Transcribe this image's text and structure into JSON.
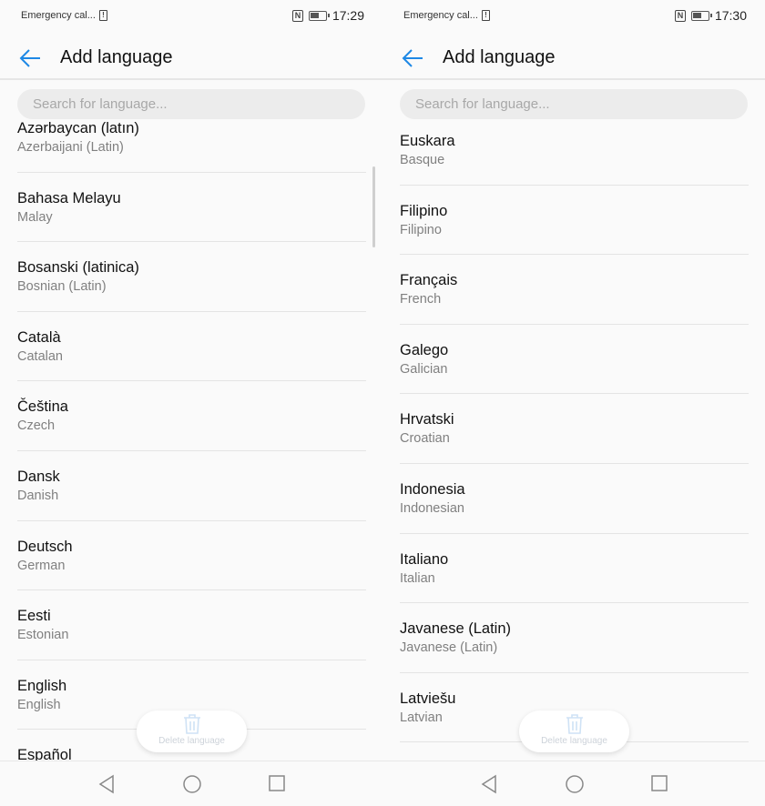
{
  "panels": [
    {
      "status": {
        "carrier": "Emergency cal...",
        "time": "17:29"
      },
      "header": {
        "title": "Add language"
      },
      "search": {
        "placeholder": "Search for language..."
      },
      "languages": [
        {
          "name": "Azərbaycan (latın)",
          "sub": "Azerbaijani (Latin)"
        },
        {
          "name": "Bahasa Melayu",
          "sub": "Malay"
        },
        {
          "name": "Bosanski (latinica)",
          "sub": "Bosnian (Latin)"
        },
        {
          "name": "Català",
          "sub": "Catalan"
        },
        {
          "name": "Čeština",
          "sub": "Czech"
        },
        {
          "name": "Dansk",
          "sub": "Danish"
        },
        {
          "name": "Deutsch",
          "sub": "German"
        },
        {
          "name": "Eesti",
          "sub": "Estonian"
        },
        {
          "name": "English",
          "sub": "English"
        },
        {
          "name": "Español",
          "sub": ""
        }
      ],
      "delete_label": "Delete language"
    },
    {
      "status": {
        "carrier": "Emergency cal...",
        "time": "17:30"
      },
      "header": {
        "title": "Add language"
      },
      "search": {
        "placeholder": "Search for language..."
      },
      "languages": [
        {
          "name": "Euskara",
          "sub": "Basque"
        },
        {
          "name": "Filipino",
          "sub": "Filipino"
        },
        {
          "name": "Français",
          "sub": "French"
        },
        {
          "name": "Galego",
          "sub": "Galician"
        },
        {
          "name": "Hrvatski",
          "sub": "Croatian"
        },
        {
          "name": "Indonesia",
          "sub": "Indonesian"
        },
        {
          "name": "Italiano",
          "sub": "Italian"
        },
        {
          "name": "Javanese (Latin)",
          "sub": "Javanese (Latin)"
        },
        {
          "name": "Latviešu",
          "sub": "Latvian"
        },
        {
          "name": "",
          "sub": ""
        }
      ],
      "delete_label": "Delete language"
    }
  ],
  "colors": {
    "accent": "#1e88e5"
  }
}
